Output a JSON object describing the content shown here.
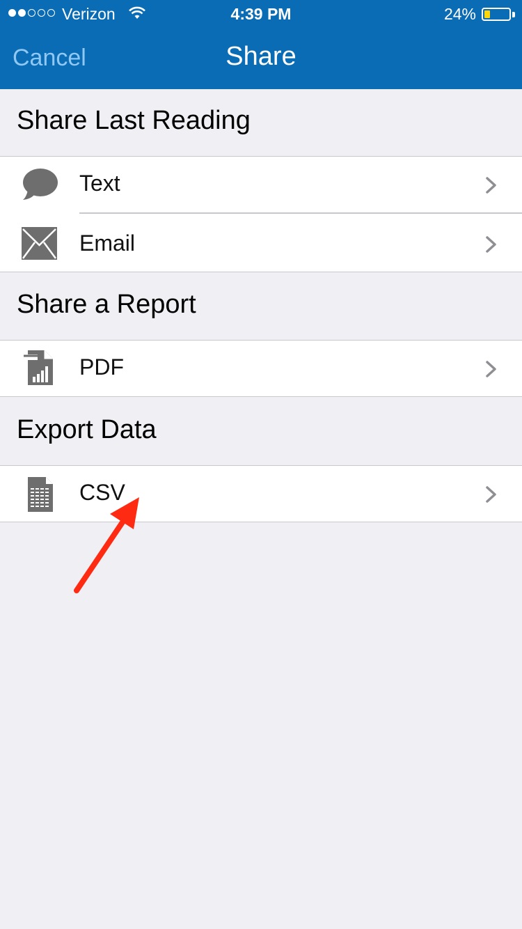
{
  "status_bar": {
    "carrier": "Verizon",
    "signal_bars_filled": 2,
    "signal_bars_total": 5,
    "time": "4:39 PM",
    "battery_percent": "24%",
    "battery_level": 0.24,
    "icons": [
      "wifi-icon",
      "battery-icon"
    ]
  },
  "navbar": {
    "cancel_label": "Cancel",
    "title": "Share"
  },
  "sections": [
    {
      "header": "Share Last Reading",
      "items": [
        {
          "label": "Text",
          "icon": "message-bubble-icon"
        },
        {
          "label": "Email",
          "icon": "envelope-icon"
        }
      ]
    },
    {
      "header": "Share a Report",
      "items": [
        {
          "label": "PDF",
          "icon": "pdf-report-icon"
        }
      ]
    },
    {
      "header": "Export Data",
      "items": [
        {
          "label": "CSV",
          "icon": "csv-spreadsheet-icon"
        }
      ]
    }
  ],
  "annotation": {
    "icon": "red-arrow-icon",
    "points_to": "CSV"
  },
  "colors": {
    "nav_bg": "#0a6cb4",
    "page_bg": "#efeff4",
    "icon_gray": "#6e6e6e",
    "chevron_gray": "#8e8e93",
    "arrow_red": "#ff2a12",
    "cancel_text": "#8fc8f2"
  }
}
